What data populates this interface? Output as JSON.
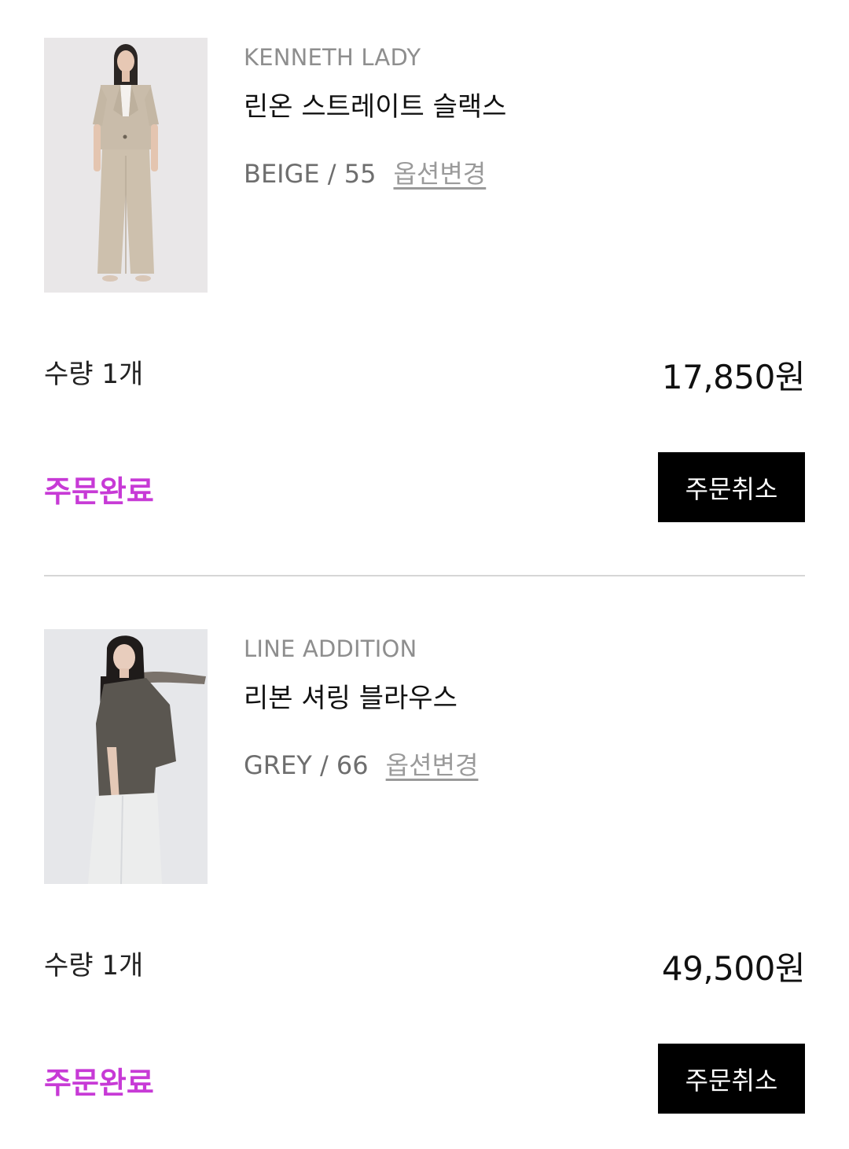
{
  "orders": [
    {
      "brand": "KENNETH LADY",
      "name": "린온 스트레이트 슬랙스",
      "option": "BEIGE / 55",
      "option_change_label": "옵션변경",
      "quantity": "수량 1개",
      "price": "17,850원",
      "status": "주문완료",
      "cancel_label": "주문취소",
      "image_icon": "product-photo-beige-suit"
    },
    {
      "brand": "LINE ADDITION",
      "name": "리본 셔링 블라우스",
      "option": "GREY / 66",
      "option_change_label": "옵션변경",
      "quantity": "수량 1개",
      "price": "49,500원",
      "status": "주문완료",
      "cancel_label": "주문취소",
      "image_icon": "product-photo-grey-blouse"
    }
  ],
  "colors": {
    "status": "#c73ad6",
    "button_bg": "#000000",
    "button_text": "#ffffff",
    "brand_text": "#8e8e8e",
    "divider": "#d6d6d6"
  }
}
